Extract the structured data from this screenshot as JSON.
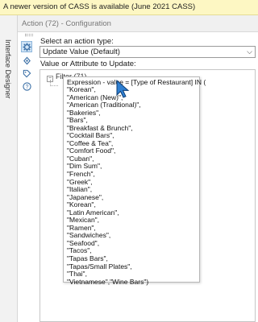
{
  "notice": {
    "text": "A newer version of CASS is available (June 2021 CASS)"
  },
  "side_tab": {
    "label": "Interface Designer"
  },
  "header": {
    "title": "Action (72) - Configuration"
  },
  "toolbar": {
    "icons": [
      "gear-icon",
      "rotate-icon",
      "tag-icon",
      "help-icon"
    ],
    "help_glyph": "?"
  },
  "form": {
    "action_type_label": "Select an action type:",
    "action_type_value": "Update Value (Default)",
    "value_label": "Value or Attribute to Update:"
  },
  "tree": {
    "toggle": "−",
    "root_label": "Filter (71)"
  },
  "popup": {
    "header": "Expression - value = [Type of Restaurant] IN (",
    "items": [
      "\"Korean\",",
      "\"American (New)\",",
      "\"American (Traditional)\",",
      "\"Bakeries\",",
      "\"Bars\",",
      "\"Breakfast & Brunch\",",
      "\"Cocktail Bars\",",
      "\"Coffee & Tea\",",
      "\"Comfort Food\",",
      "\"Cuban\",",
      "\"Dim Sum\",",
      "\"French\",",
      "\"Greek\",",
      "\"Italian\",",
      "\"Japanese\",",
      "\"Korean\",",
      "\"Latin American\",",
      "\"Mexican\",",
      "\"Ramen\",",
      "\"Sandwiches\",",
      "\"Seafood\",",
      "\"Tacos\",",
      "\"Tapas Bars\",",
      "\"Tapas/Small Plates\",",
      "\"Thai\",",
      "\"Vietnamese\",\"Wine Bars\") "
    ]
  },
  "colors": {
    "notice_bg": "#fdf7c3",
    "accent": "#3a6ea5",
    "selected_bg": "#cfe3f5",
    "cursor": "#2f7fd1"
  }
}
